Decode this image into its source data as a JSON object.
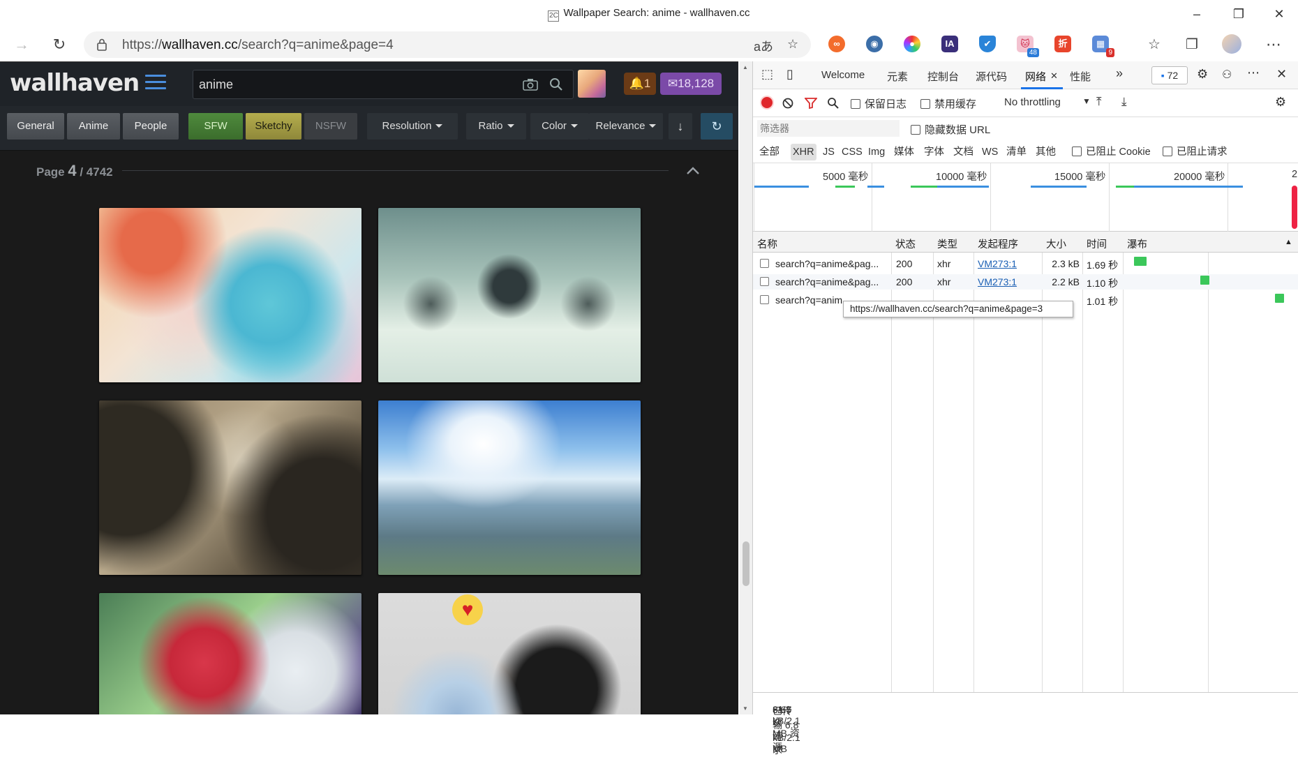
{
  "window": {
    "title": "Wallpaper Search: anime - wallhaven.cc",
    "favicon": "2C"
  },
  "addressbar": {
    "url_prefix": "https://",
    "url_host": "wallhaven.cc",
    "url_path": "/search?q=anime&page=4"
  },
  "extensions": {
    "badge_1": "48",
    "badge_2": "9"
  },
  "wallhaven": {
    "logo": "wallhaven",
    "search_value": "anime",
    "notifications": "1",
    "credits": "18,128",
    "filters": {
      "general": "General",
      "anime": "Anime",
      "people": "People",
      "sfw": "SFW",
      "sketchy": "Sketchy",
      "nsfw": "NSFW",
      "resolution": "Resolution",
      "ratio": "Ratio",
      "color": "Color",
      "relevance": "Relevance"
    },
    "page": {
      "label": "Page",
      "current": "4",
      "total": "/ 4742"
    }
  },
  "devtools": {
    "tabs": {
      "welcome": "Welcome",
      "elements": "元素",
      "console": "控制台",
      "sources": "源代码",
      "network": "网络",
      "performance": "性能",
      "more": "»",
      "issues_count": "72"
    },
    "toolbar": {
      "preserve_log": "保留日志",
      "disable_cache": "禁用缓存",
      "throttling": "No throttling"
    },
    "filter": {
      "placeholder": "筛选器",
      "hide_data_url": "隐藏数据 URL"
    },
    "types": {
      "all": "全部",
      "xhr": "XHR",
      "js": "JS",
      "css": "CSS",
      "img": "Img",
      "media": "媒体",
      "font": "字体",
      "doc": "文档",
      "ws": "WS",
      "manifest": "清单",
      "other": "其他",
      "blocked_cookies": "已阻止 Cookie",
      "blocked_requests": "已阻止请求"
    },
    "timeline": [
      "5000 毫秒",
      "10000 毫秒",
      "15000 毫秒",
      "20000 毫秒",
      "2"
    ],
    "columns": {
      "name": "名称",
      "status": "状态",
      "type": "类型",
      "initiator": "发起程序",
      "size": "大小",
      "time": "时间",
      "waterfall": "瀑布"
    },
    "requests": [
      {
        "name": "search?q=anime&pag...",
        "status": "200",
        "type": "xhr",
        "initiator": "VM273:1",
        "size": "2.3 kB",
        "time": "1.69 秒"
      },
      {
        "name": "search?q=anime&pag...",
        "status": "200",
        "type": "xhr",
        "initiator": "VM273:1",
        "size": "2.2 kB",
        "time": "1.10 秒"
      },
      {
        "name": "search?q=anim",
        "status": "",
        "type": "",
        "initiator": "",
        "size": "",
        "time": "1.01 秒"
      }
    ],
    "tooltip": "https://wallhaven.cc/search?q=anime&page=3",
    "status": {
      "requests": "3/67 次请求",
      "transferred": "已传输 6.8 kB/2.1 MB",
      "resources": "61.5 kB/2.1 MB 资源"
    }
  }
}
